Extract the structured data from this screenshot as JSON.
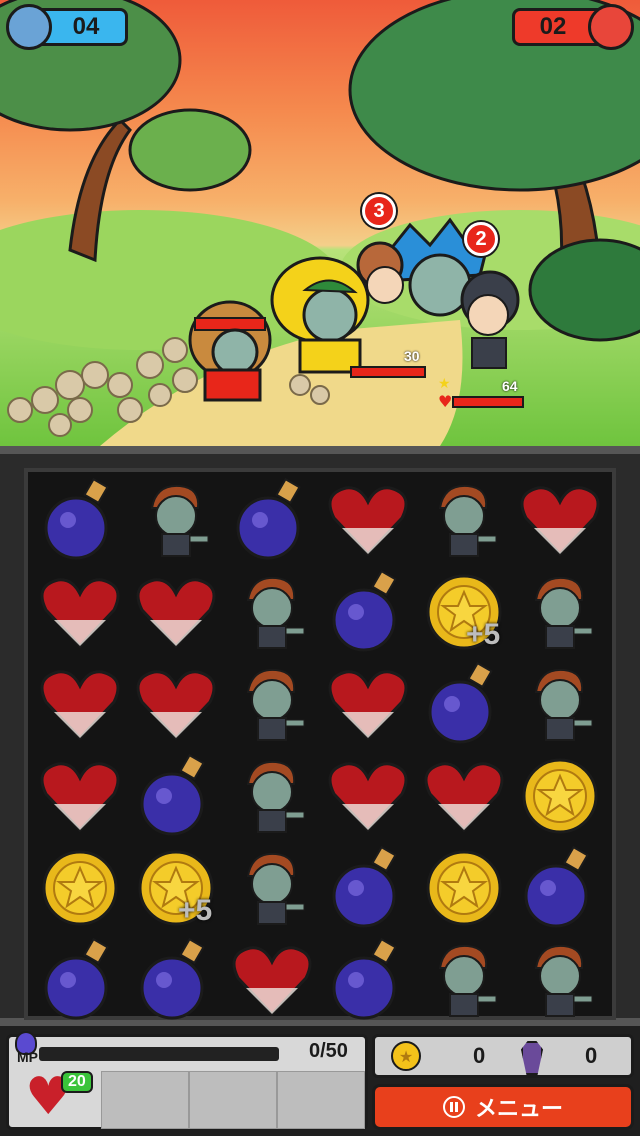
{
  "hud": {
    "player_score": "04",
    "enemy_score": "02"
  },
  "enemies": {
    "badge_1": "3",
    "badge_2": "2",
    "hp_1": "30",
    "hp_2": "64"
  },
  "board": {
    "rows": [
      [
        "potion",
        "zombie",
        "potion",
        "heart",
        "zombie",
        "heart"
      ],
      [
        "heart",
        "heart",
        "zombie",
        "potion",
        "coin",
        "zombie"
      ],
      [
        "heart",
        "heart",
        "zombie",
        "heart",
        "potion",
        "zombie"
      ],
      [
        "heart",
        "potion",
        "zombie",
        "heart",
        "heart",
        "coin"
      ],
      [
        "coin",
        "coin",
        "zombie",
        "potion",
        "coin",
        "potion"
      ],
      [
        "potion",
        "potion",
        "heart",
        "potion",
        "zombie",
        "zombie"
      ]
    ],
    "bonus_1": "+5",
    "bonus_2": "+5"
  },
  "footer": {
    "mp_label": "MP",
    "mp_value": "0/50",
    "heart_count": "20",
    "coin_count": "0",
    "coffin_count": "0",
    "menu_label": "メニュー"
  },
  "colors": {
    "accent_blue": "#3ab6ee",
    "accent_red": "#ee3a2a",
    "menu_orange": "#e8401c"
  }
}
